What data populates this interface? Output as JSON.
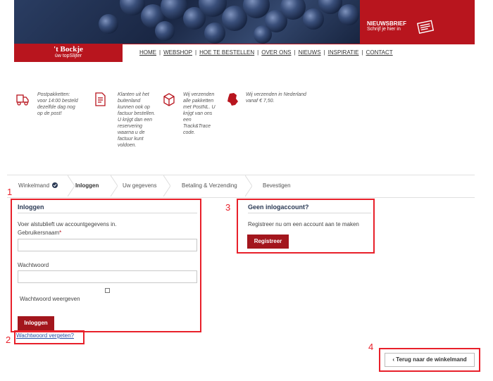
{
  "newsletter": {
    "title": "NIEUWSBRIEF",
    "subtitle": "Schrijf je hier in"
  },
  "brand": {
    "name": "'t Bockje",
    "tagline": "úw topSlijter"
  },
  "nav": {
    "items": [
      "HOME",
      "WEBSHOP",
      "HOE TE BESTELLEN",
      "OVER ONS",
      "NIEUWS",
      "INSPIRATIE",
      "CONTACT"
    ],
    "separator": "|"
  },
  "usps": [
    {
      "icon": "delivery-truck-icon",
      "lines": [
        "Postpakketten:",
        "voor 14:00 besteld",
        "dezelfde dag nog",
        "op de post!"
      ]
    },
    {
      "icon": "invoice-icon",
      "lines": [
        "Klanten uit het",
        "buitenland",
        "kunnen ook op",
        "factuur bestellen.",
        "U krijgt dan een",
        "reservering",
        "waarna u de",
        "factuur kunt",
        "voldoen."
      ]
    },
    {
      "icon": "package-icon",
      "lines": [
        "Wij verzenden",
        "alle pakketten",
        "met PostNL. U",
        "krijgt van ons",
        "een",
        "Track&Trace",
        "code."
      ]
    },
    {
      "icon": "netherlands-map-icon",
      "lines": [
        "Wij verzenden in Nederland",
        "vanaf € 7,50."
      ]
    }
  ],
  "steps": [
    "Winkelmand",
    "Inloggen",
    "Uw gegevens",
    "Betaling & Verzending",
    "Bevestigen"
  ],
  "login": {
    "title": "Inloggen",
    "intro": "Voer alstublieft uw accountgegevens in.",
    "username_label": "Gebruikersnaam",
    "required_mark": "*",
    "username_value": "",
    "password_label": "Wachtwoord",
    "password_value": "",
    "show_password_label": "Wachtwoord weergeven",
    "submit_label": "Inloggen",
    "forgot_label": "Wachtwoord vergeten?"
  },
  "register": {
    "title": "Geen inlogaccount?",
    "text": "Registreer nu om een account aan te maken",
    "button_label": "Registreer"
  },
  "back_button": {
    "chevron": "‹",
    "label": "Terug naar de winkelmand"
  },
  "annotations": [
    "1",
    "2",
    "3",
    "4"
  ],
  "colors": {
    "brand_red": "#b8151e",
    "button_red": "#a3161d",
    "annotation_red": "#e8202a",
    "title_blue": "#2b3a55",
    "success_green": "#2b3a55"
  }
}
